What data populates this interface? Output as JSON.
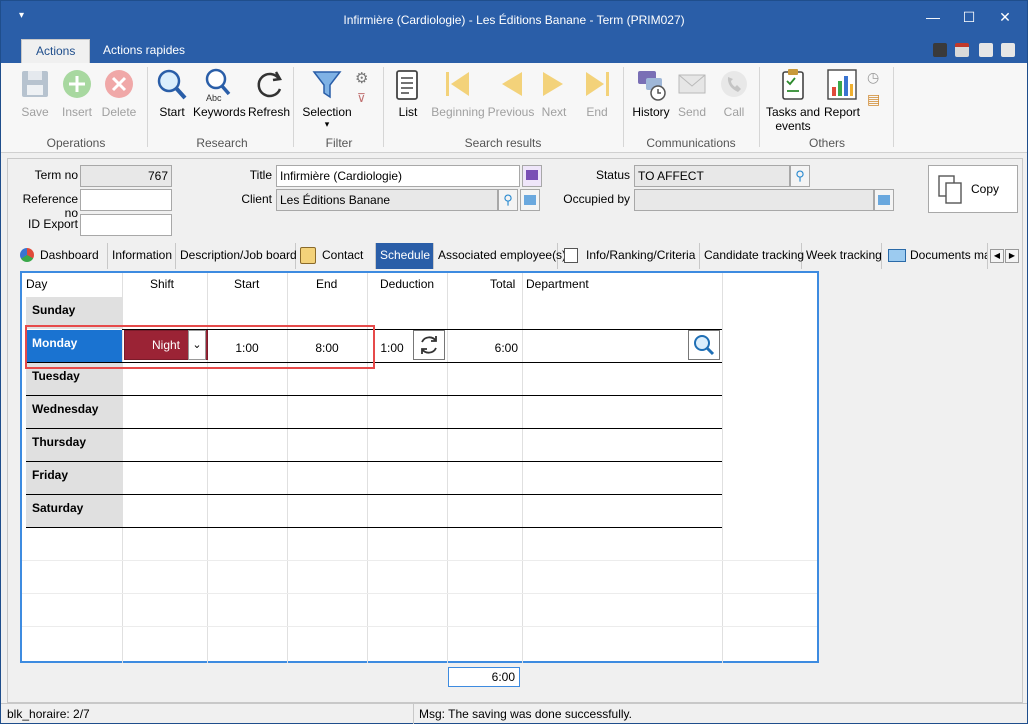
{
  "window": {
    "title": "Infirmière (Cardiologie) - Les Éditions Banane - Term (PRIM027)"
  },
  "menu_tabs": [
    "Actions",
    "Actions rapides"
  ],
  "ribbon": {
    "operations": {
      "label": "Operations",
      "save": "Save",
      "insert": "Insert",
      "delete": "Delete"
    },
    "research": {
      "label": "Research",
      "start": "Start",
      "keywords": "Keywords",
      "refresh": "Refresh"
    },
    "filter": {
      "label": "Filter",
      "selection": "Selection"
    },
    "search_results": {
      "label": "Search results",
      "list": "List",
      "beginning": "Beginning",
      "previous": "Previous",
      "next": "Next",
      "end": "End"
    },
    "communications": {
      "label": "Communications",
      "history": "History",
      "send": "Send",
      "call": "Call"
    },
    "others": {
      "label": "Others",
      "tasks_line1": "Tasks and",
      "tasks_line2": "events",
      "report": "Report"
    }
  },
  "form": {
    "term_no_label": "Term no",
    "term_no": "767",
    "reference_no_label": "Reference no",
    "reference_no": "",
    "id_export_label": "ID Export",
    "id_export": "",
    "title_label": "Title",
    "title": "Infirmière (Cardiologie)",
    "client_label": "Client",
    "client": "Les Éditions Banane",
    "status_label": "Status",
    "status": "TO AFFECT",
    "occupied_by_label": "Occupied by",
    "occupied_by": "",
    "copy_label": "Copy"
  },
  "tabs": [
    "Dashboard",
    "Information",
    "Description/Job board",
    "Contact",
    "Schedule",
    "Associated employee(s)",
    "Info/Ranking/Criteria",
    "Candidate tracking",
    "Week tracking",
    "Documents mar"
  ],
  "schedule": {
    "columns": {
      "day": "Day",
      "shift": "Shift",
      "start": "Start",
      "end": "End",
      "deduction": "Deduction",
      "total": "Total",
      "department": "Department"
    },
    "days": [
      "Sunday",
      "Monday",
      "Tuesday",
      "Wednesday",
      "Thursday",
      "Friday",
      "Saturday"
    ],
    "monday": {
      "shift": "Night",
      "start": "1:00",
      "end": "8:00",
      "deduction": "1:00",
      "total": "6:00"
    },
    "grand_total": "6:00"
  },
  "status": {
    "left": "blk_horaire: 2/7",
    "msg": "Msg: The saving was done successfully."
  }
}
